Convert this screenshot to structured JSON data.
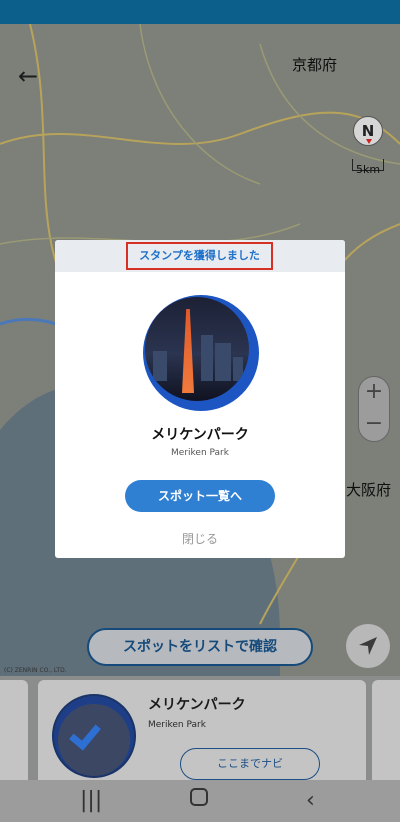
{
  "map": {
    "label_kyoto": "京都府",
    "label_osaka": "大阪府",
    "copyright": "(C) ZENRIN CO., LTD.",
    "compass_letter": "N",
    "scale_label": "5km",
    "zoom_in": "+",
    "zoom_out": "−",
    "back_icon": "arrow-left-icon",
    "list_confirm_label": "スポットをリストで確認"
  },
  "card": {
    "title": "メリケンパーク",
    "subtitle": "Meriken Park",
    "nav_label": "ここまでナビ"
  },
  "modal": {
    "title": "スタンプを獲得しました",
    "spot_name": "メリケンパーク",
    "spot_sub": "Meriken Park",
    "spot_list_label": "スポット一覧へ",
    "close_label": "閉じる"
  },
  "colors": {
    "accent": "#2f7fd3",
    "highlight_border": "#d63025",
    "status_bar": "#0c5f8b"
  }
}
